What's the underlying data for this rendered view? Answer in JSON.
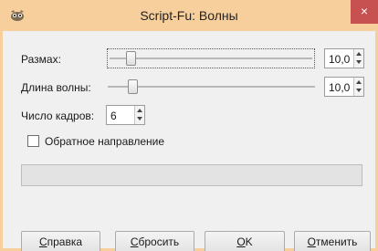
{
  "window": {
    "title": "Script-Fu: Волны",
    "close_glyph": "×"
  },
  "params": {
    "amplitude": {
      "label": "Размах:",
      "value": "10,0"
    },
    "wavelength": {
      "label": "Длина волны:",
      "value": "10,0"
    },
    "frames": {
      "label": "Число кадров:",
      "value": "6"
    },
    "reverse": {
      "label": "Обратное направление",
      "checked": false
    }
  },
  "buttons": {
    "help": {
      "ul": "С",
      "rest": "правка"
    },
    "reset": {
      "ul": "С",
      "rest": "бросить"
    },
    "ok": {
      "ul": "O",
      "rest": "K"
    },
    "cancel": {
      "ul": "О",
      "rest": "тменить"
    }
  },
  "colors": {
    "titlebar": "#f6cf9c",
    "close": "#c75050"
  }
}
